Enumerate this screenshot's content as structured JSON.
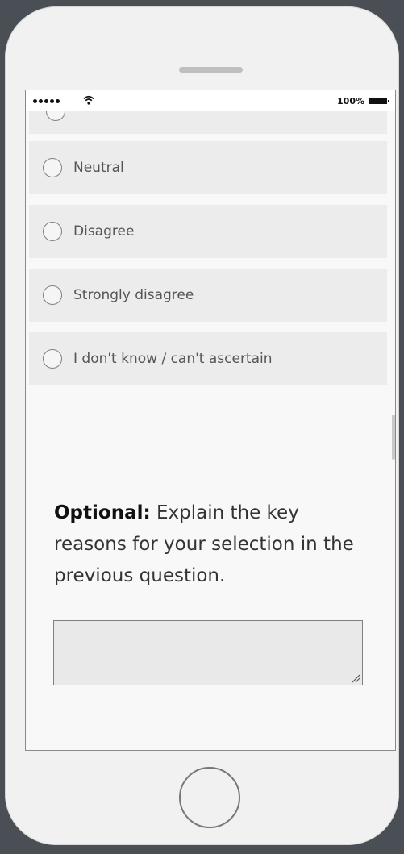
{
  "status_bar": {
    "battery_percent": "100%",
    "wifi_icon": "wifi-icon",
    "signal_icon": "signal-dots-icon",
    "battery_icon": "battery-icon"
  },
  "question": {
    "options": [
      {
        "label": "Neutral"
      },
      {
        "label": "Disagree"
      },
      {
        "label": "Strongly disagree"
      },
      {
        "label": "I don't know / can't ascertain"
      }
    ]
  },
  "optional_prompt": {
    "lead": "Optional:",
    "text": " Explain the key reasons for your selection in the previous question."
  },
  "colors": {
    "frame": "#f1f1f1",
    "option_bg": "#ececec",
    "outer_bg": "#4a4e55"
  }
}
